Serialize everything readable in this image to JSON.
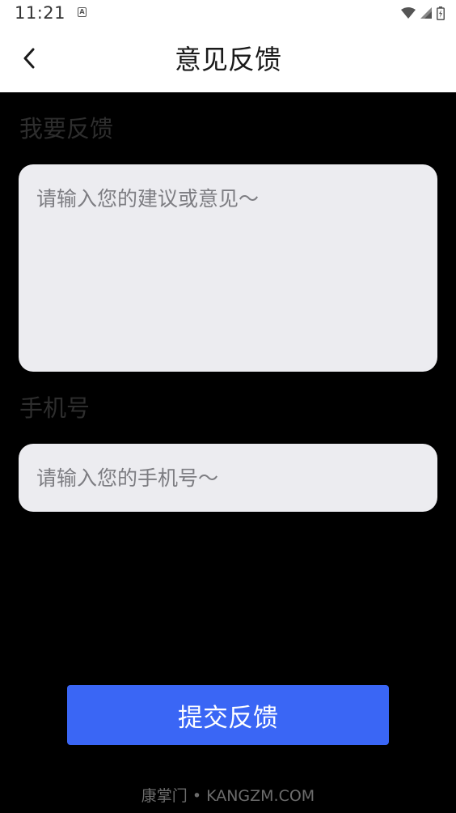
{
  "status_bar": {
    "time": "11:21",
    "notification_icon": "a-box-icon",
    "notification_glyph": "A",
    "icons": [
      "wifi-icon",
      "signal-icon",
      "battery-charging-icon"
    ]
  },
  "header": {
    "back_icon": "chevron-left-icon",
    "title": "意见反馈"
  },
  "form": {
    "feedback": {
      "label": "我要反馈",
      "placeholder": "请输入您的建议或意见～",
      "value": ""
    },
    "phone": {
      "label": "手机号",
      "placeholder": "请输入您的手机号～",
      "value": ""
    },
    "submit_label": "提交反馈"
  },
  "footer": {
    "brand": "康掌门 • KANGZM.COM"
  },
  "colors": {
    "background": "#000000",
    "header_background": "#ffffff",
    "field_background": "#ececf0",
    "accent": "#3a66f5"
  }
}
